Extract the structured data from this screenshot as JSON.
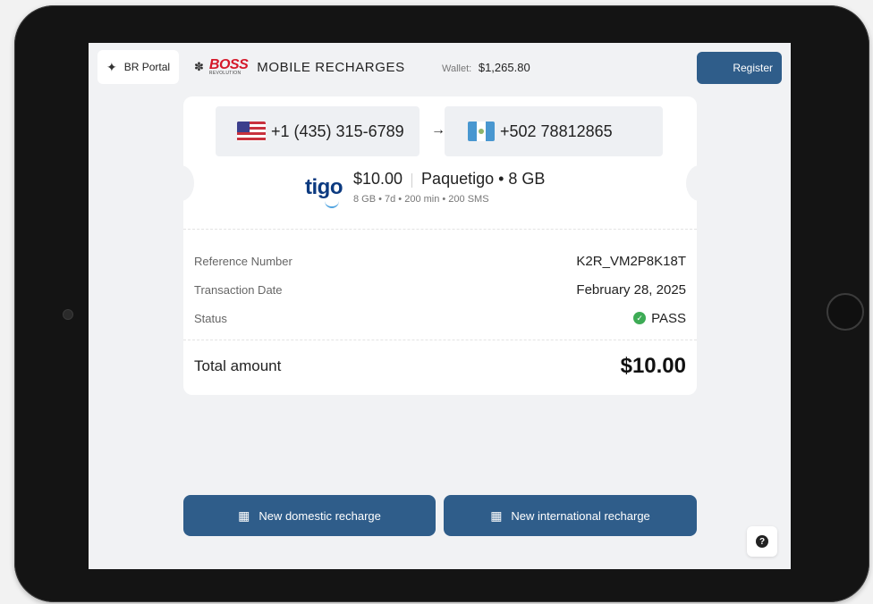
{
  "header": {
    "portal_label": "BR Portal",
    "logo_text": "BOSS",
    "logo_subtext": "REVOLUTION",
    "app_title": "MOBILE RECHARGES",
    "wallet_label": "Wallet:",
    "wallet_value": "$1,265.80",
    "register_label": "Register"
  },
  "recharge": {
    "from_number": "+1 (435) 315-6789",
    "arrow": "→",
    "to_number": "+502 78812865",
    "carrier_logo": "tigo",
    "price": "$10.00",
    "plan_name": "Paquetigo • 8 GB",
    "plan_details": "8 GB • 7d • 200 min • 200 SMS"
  },
  "transaction": {
    "reference_label": "Reference Number",
    "reference_value": "K2R_VM2P8K18T",
    "date_label": "Transaction Date",
    "date_value": "February 28, 2025",
    "status_label": "Status",
    "status_value": "PASS",
    "status_color": "#3dab55"
  },
  "total": {
    "label": "Total amount",
    "value": "$10.00"
  },
  "actions": {
    "domestic_label": "New domestic recharge",
    "international_label": "New international recharge",
    "help_symbol": "?"
  },
  "colors": {
    "primary": "#2f5d8a",
    "brand_red": "#d5182a",
    "tigo_blue": "#0c3a80"
  },
  "icons": {
    "portal": "tag-icon",
    "domestic": "phone-receipt-icon",
    "international": "phone-receipt-icon",
    "help": "question-circle-icon"
  }
}
